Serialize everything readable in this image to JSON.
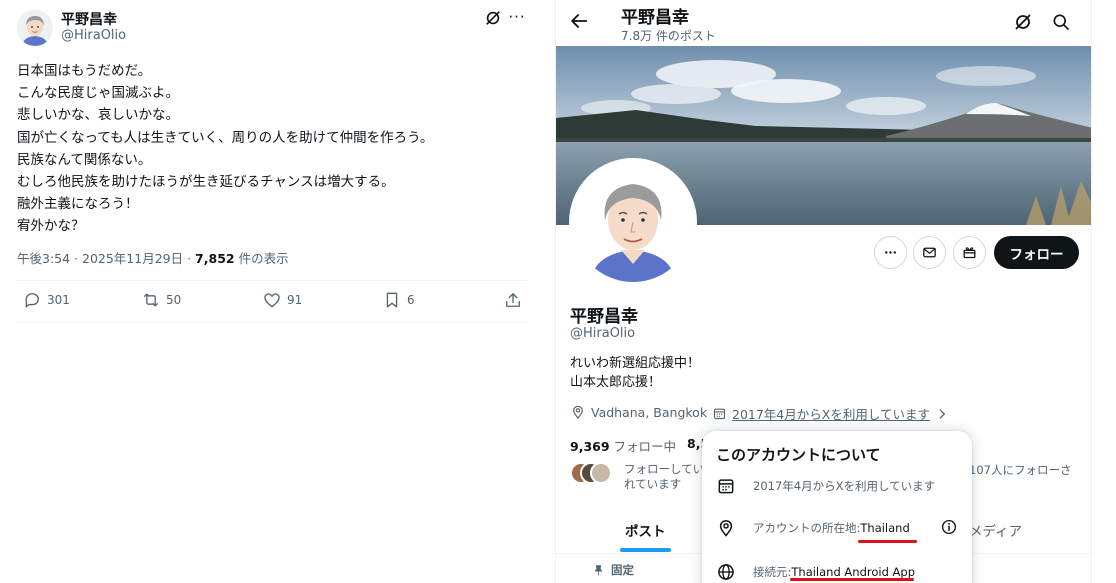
{
  "tweet": {
    "display_name": "平野昌幸",
    "handle": "@HiraOlio",
    "more_label": "···",
    "lines": [
      "日本国はもうだめだ。",
      "こんな民度じゃ国滅ぶよ。",
      "悲しいかな、哀しいかな。",
      "国が亡くなっても人は生きていく、周りの人を助けて仲間を作ろう。",
      "民族なんて関係ない。",
      "むしろ他民族を助けたほうが生き延びるチャンスは増大する。",
      "融外主義になろう！",
      "宥外かな？"
    ],
    "timestamp": "午後3:54 · 2025年11月29日 · ",
    "views": "7,852",
    "views_suffix": " 件の表示",
    "actions": {
      "replies": "301",
      "reposts": "50",
      "likes": "91",
      "bookmarks": "6"
    }
  },
  "profile": {
    "title": "平野昌幸",
    "post_count": "7.8万 件のポスト",
    "follow_label": "フォロー",
    "name": "平野昌幸",
    "handle": "@HiraOlio",
    "bio_lines": [
      "れいわ新選組応援中！",
      "山本太郎応援！"
    ],
    "location": "Vadhana, Bangkok",
    "joined": "2017年4月からXを利用しています",
    "following_count": "9,369",
    "following_label": " フォロー中",
    "followers_count_partial": "8,5",
    "followed_by_left": "フォローしていれています",
    "followed_by_right": "107人にフォローさ",
    "tab_posts": "ポスト",
    "tab_media": "メディア",
    "pinned_label": "固定"
  },
  "popup": {
    "title": "このアカウントについて",
    "joined": "2017年4月からXを利用しています",
    "location_label": "アカウントの所在地: ",
    "location_value": "Thailand",
    "connected_label": "接続元: ",
    "connected_value": "Thailand Android App"
  },
  "colors": {
    "accent": "#1d9bf0",
    "text": "#0f1419",
    "muted": "#536471",
    "annotation_red": "#e0101a"
  }
}
